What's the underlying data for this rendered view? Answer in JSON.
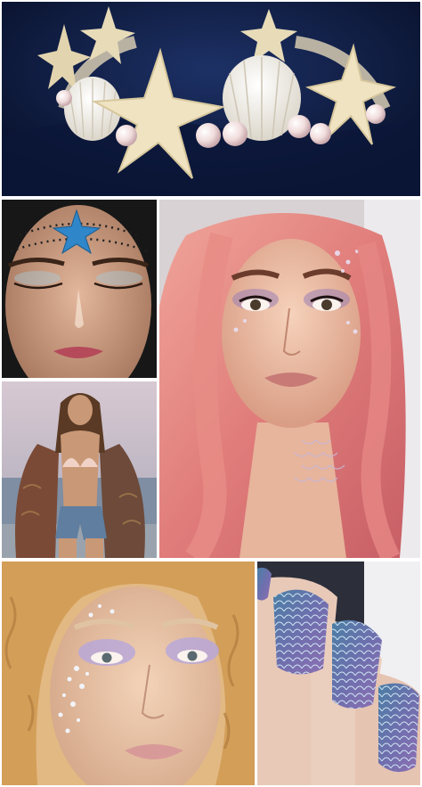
{
  "collage": {
    "background": "#ffffff",
    "tiles": [
      {
        "id": "crown",
        "subject": "starfish-and-seashell-crown",
        "palette": [
          "#0c1a3c",
          "#efe3c2",
          "#f3ece0",
          "#e8ccd0"
        ]
      },
      {
        "id": "face1",
        "subject": "blue-starfish-forehead-makeup",
        "palette": [
          "#2f86c8",
          "#caa188",
          "#1c1c1c"
        ]
      },
      {
        "id": "pink",
        "subject": "pink-hair-mermaid-makeup",
        "palette": [
          "#e68a86",
          "#f0bfa6",
          "#9a7fb4"
        ]
      },
      {
        "id": "beach",
        "subject": "seashell-bikini-beach",
        "palette": [
          "#bfb6c4",
          "#8a93a4",
          "#7b4a36",
          "#5f7ea0"
        ]
      },
      {
        "id": "glitter",
        "subject": "glitter-cheek-makeup",
        "palette": [
          "#d5a45e",
          "#ecc9ac",
          "#b6a6dc"
        ]
      },
      {
        "id": "nails",
        "subject": "mermaid-scale-nails",
        "palette": [
          "#2c2e3a",
          "#4a7fa4",
          "#8e6fb2",
          "#e8c9b8"
        ]
      }
    ]
  }
}
